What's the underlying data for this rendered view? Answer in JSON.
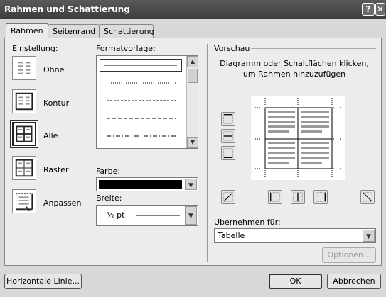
{
  "window": {
    "title": "Rahmen und Schattierung",
    "help_label": "?",
    "close_label": "✕"
  },
  "tabs": [
    "Rahmen",
    "Seitenrand",
    "Schattierung"
  ],
  "settings": {
    "label": "Einstellung:",
    "items": [
      {
        "label": "Ohne",
        "icon": "settings-none-icon"
      },
      {
        "label": "Kontur",
        "icon": "settings-box-icon"
      },
      {
        "label": "Alle",
        "icon": "settings-all-icon",
        "selected": true
      },
      {
        "label": "Raster",
        "icon": "settings-grid-icon"
      },
      {
        "label": "Anpassen",
        "icon": "settings-custom-icon"
      }
    ]
  },
  "style": {
    "label": "Formatvorlage:",
    "items": [
      "solid",
      "dotted",
      "dashed-small",
      "dashed",
      "dash-dot"
    ],
    "selected_index": 0
  },
  "color": {
    "label": "Farbe:",
    "value": "#000000"
  },
  "width": {
    "label": "Breite:",
    "value": "½ pt"
  },
  "preview": {
    "label": "Vorschau",
    "instruction": "Diagramm oder Schaltflächen klicken, um Rahmen hinzuzufügen"
  },
  "apply_to": {
    "label": "Übernehmen für:",
    "value": "Tabelle"
  },
  "buttons": {
    "options": "Optionen...",
    "horizontal_line": "Horizontale Linie...",
    "ok": "OK",
    "cancel": "Abbrechen"
  },
  "colors": {
    "titlebar": "#4a4a4a",
    "panel": "#ececec",
    "dialog": "#d8d8d8"
  }
}
